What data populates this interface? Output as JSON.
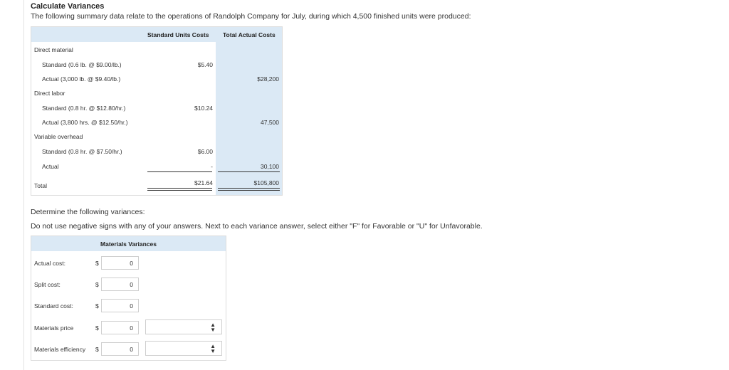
{
  "header": {
    "title": "Calculate Variances",
    "intro": "The following summary data relate to the operations of Randolph Company for July, during which 4,500 finished units were produced:"
  },
  "summary_table": {
    "col_standard": "Standard Units Costs",
    "col_actual": "Total Actual Costs",
    "direct_material": {
      "label": "Direct material",
      "standard_label": "Standard (0.6 lb. @ $9.00/lb.)",
      "standard_value": "$5.40",
      "actual_label": "Actual (3,000 lb. @ $9.40/lb.)",
      "actual_value": "$28,200"
    },
    "direct_labor": {
      "label": "Direct labor",
      "standard_label": "Standard (0.8 hr. @ $12.80/hr.)",
      "standard_value": "$10.24",
      "actual_label": "Actual (3,800 hrs. @ $12.50/hr.)",
      "actual_value": "47,500"
    },
    "variable_overhead": {
      "label": "Variable overhead",
      "standard_label": "Standard (0.8 hr. @ $7.50/hr.)",
      "standard_value": "$6.00",
      "actual_label": "Actual",
      "actual_standard_value": "-",
      "actual_value": "30,100"
    },
    "total": {
      "label": "Total",
      "standard_value": "$21.64",
      "actual_value": "$105,800"
    }
  },
  "instructions": {
    "line1": "Determine the following variances:",
    "line2": "Do not use negative signs with any of your answers. Next to each variance answer, select either \"F\" for Favorable or \"U\" for Unfavorable."
  },
  "materials_variances": {
    "title": "Materials Variances",
    "currency": "$",
    "rows": [
      {
        "label": "Actual cost:",
        "value": "0"
      },
      {
        "label": "Split cost:",
        "value": "0"
      },
      {
        "label": "Standard cost:",
        "value": "0"
      },
      {
        "label": "Materials price",
        "value": "0",
        "select_value": ""
      },
      {
        "label": "Materials efficiency",
        "value": "0",
        "select_value": ""
      }
    ]
  },
  "colors": {
    "header_bg": "#dbe9f5",
    "border": "#dcdcdc"
  }
}
